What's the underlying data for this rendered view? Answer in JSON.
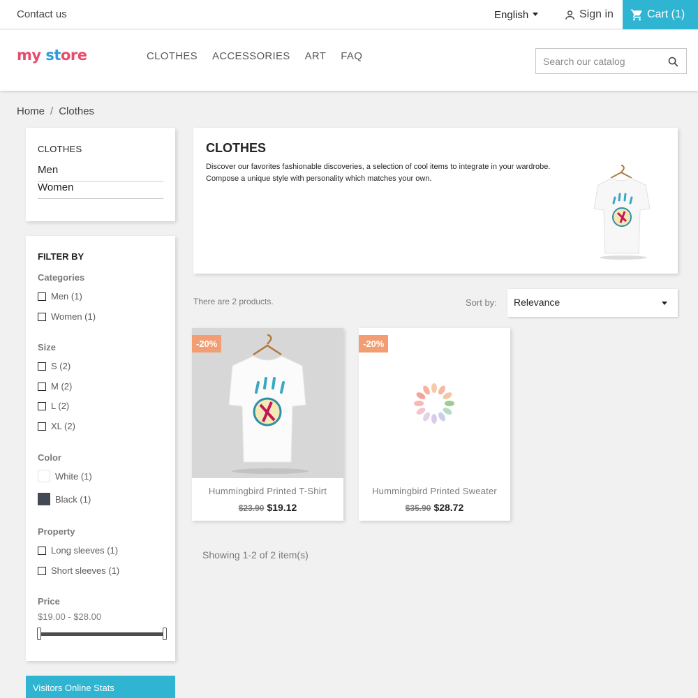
{
  "topbar": {
    "contact": "Contact us",
    "language": "English",
    "signin": "Sign in",
    "cart": "Cart (1)"
  },
  "header": {
    "logo": {
      "part1": "my",
      "part2": " ",
      "part3": "st",
      "part4": "ore"
    },
    "menu": [
      "CLOTHES",
      "ACCESSORIES",
      "ART",
      "FAQ"
    ],
    "search_placeholder": "Search our catalog"
  },
  "breadcrumb": {
    "home": "Home",
    "sep": "/",
    "current": "Clothes"
  },
  "categories": {
    "title": "CLOTHES",
    "items": [
      "Men",
      "Women"
    ]
  },
  "filters": {
    "title": "FILTER BY",
    "categories": {
      "heading": "Categories",
      "options": [
        "Men (1)",
        "Women (1)"
      ]
    },
    "size": {
      "heading": "Size",
      "options": [
        "S (2)",
        "M (2)",
        "L (2)",
        "XL (2)"
      ]
    },
    "color": {
      "heading": "Color",
      "options": [
        {
          "label": "White (1)",
          "swatch": "#ffffff"
        },
        {
          "label": "Black (1)",
          "swatch": "#434a54"
        }
      ]
    },
    "property": {
      "heading": "Property",
      "options": [
        "Long sleeves (1)",
        "Short sleeves (1)"
      ]
    },
    "price": {
      "heading": "Price",
      "range": "$19.00 - $28.00",
      "min": 19.0,
      "max": 28.0,
      "low": 0.0,
      "high": 1.0
    }
  },
  "visitors": {
    "title": "Visitors Online Stats"
  },
  "category_block": {
    "title": "CLOTHES",
    "description_1": "Discover our favorites fashionable discoveries, a selection of cool items to integrate in your wardrobe.",
    "description_2": "Compose a unique style with personality which matches your own."
  },
  "listing": {
    "count": "There are 2 products.",
    "sort_label": "Sort by:",
    "sort_value": "Relevance",
    "showing": "Showing 1-2 of 2 item(s)"
  },
  "products": [
    {
      "badge": "-20%",
      "name": "Hummingbird Printed T-Shirt",
      "old_price": "$23.90",
      "price": "$19.12"
    },
    {
      "badge": "-20%",
      "name": "Hummingbird Printed Sweater",
      "old_price": "$35.90",
      "price": "$28.72"
    }
  ],
  "colors": {
    "accent": "#2fb5d2",
    "badge": "#f39d72"
  }
}
